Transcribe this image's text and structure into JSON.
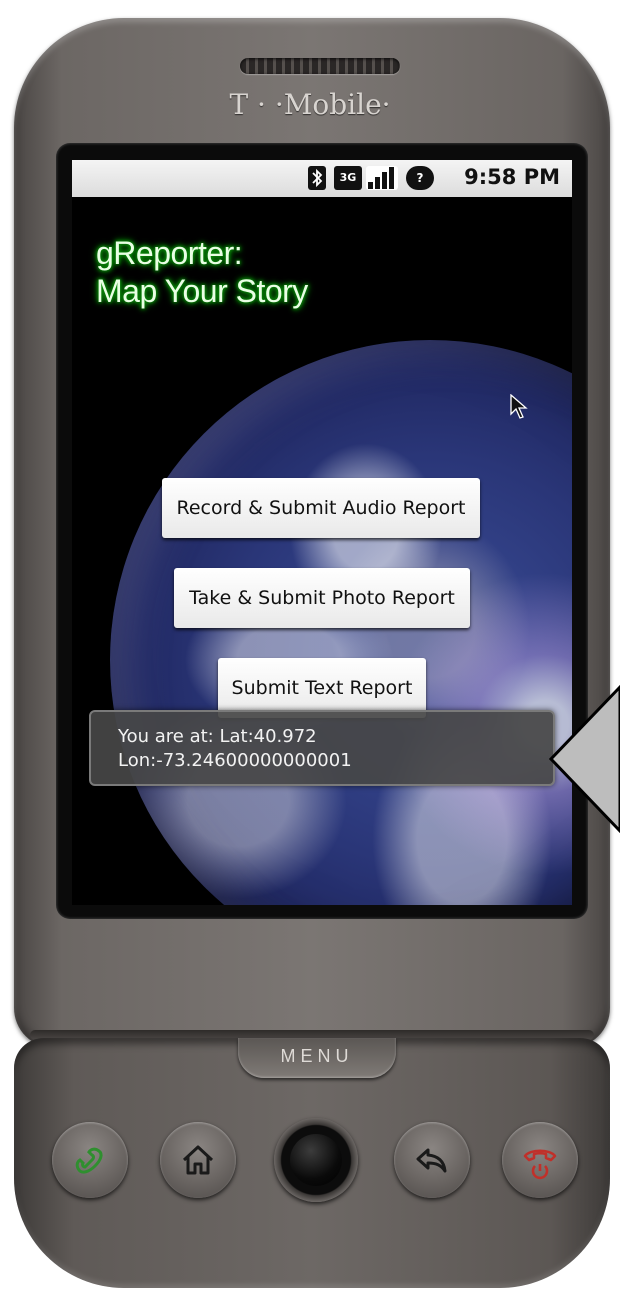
{
  "device": {
    "brand": "T · ·Mobile·",
    "menu_label": "MENU"
  },
  "status_bar": {
    "time": "9:58 PM",
    "icons": [
      "bluetooth-icon",
      "3g-data-icon",
      "signal-strength-icon",
      "notification-unknown-icon"
    ],
    "network_label": "3G"
  },
  "app": {
    "title_line1": "gReporter:",
    "title_line2": "Map Your Story",
    "title_glow_color": "#0ca10c",
    "buttons": {
      "audio": "Record & Submit Audio Report",
      "photo": "Take & Submit Photo Report",
      "text": "Submit Text Report"
    },
    "toast": {
      "line1": "You are at: Lat:40.972",
      "line2": "Lon:-73.24600000000001"
    }
  },
  "hardware_buttons": [
    "call-icon",
    "home-icon",
    "trackball",
    "back-icon",
    "end-call-icon"
  ],
  "colors": {
    "call_green": "#2f8f2f",
    "end_red": "#c0302a"
  }
}
